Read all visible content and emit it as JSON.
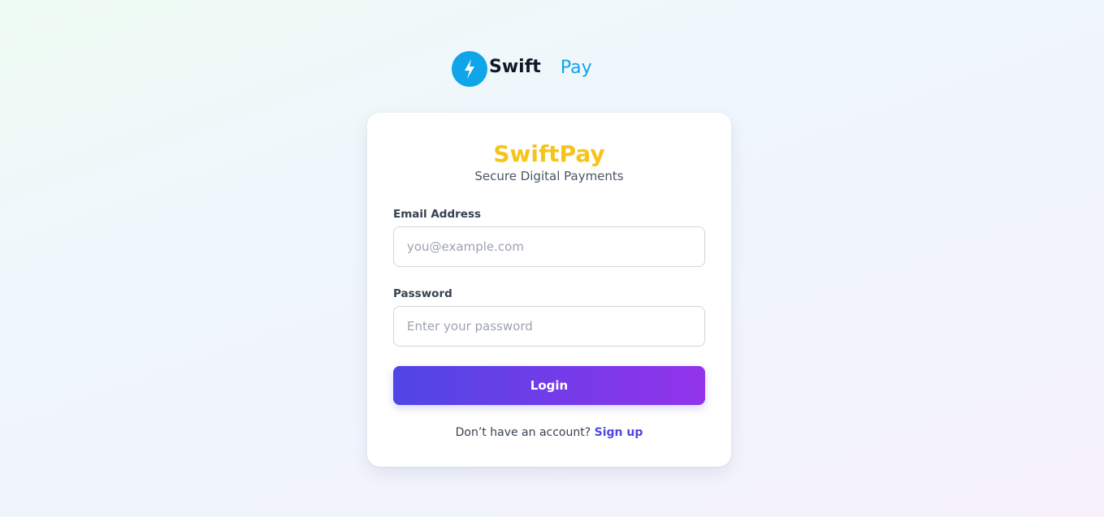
{
  "logo": {
    "icon": "lightning-bolt-icon",
    "swift": "Swift",
    "pay": "Pay",
    "circle_color": "#0ea5e9"
  },
  "card": {
    "brand": "SwiftPay",
    "brand_color": "#f6c418",
    "tagline": "Secure Digital Payments"
  },
  "form": {
    "email_label": "Email Address",
    "email_placeholder": "you@example.com",
    "email_value": "",
    "password_label": "Password",
    "password_placeholder": "Enter your password",
    "password_value": "",
    "login_label": "Login"
  },
  "signup": {
    "prompt": "Don’t have an account?",
    "link": "Sign up"
  },
  "colors": {
    "accent_start": "#4f46e5",
    "accent_end": "#9333ea"
  }
}
